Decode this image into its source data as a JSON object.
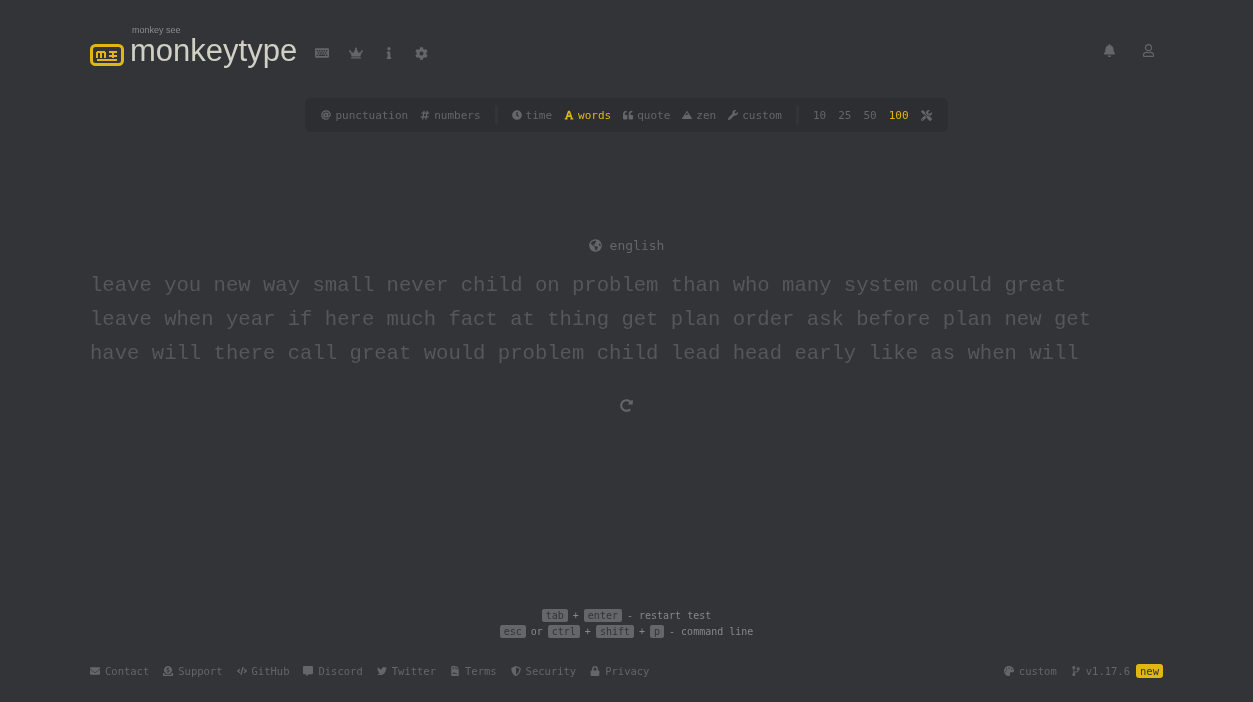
{
  "logo": {
    "tagline": "monkey see",
    "name": "monkeytype"
  },
  "config": {
    "toggles": [
      {
        "kind": "at",
        "label": "punctuation",
        "selected": false
      },
      {
        "kind": "hash",
        "label": "numbers",
        "selected": false
      }
    ],
    "modes": [
      {
        "kind": "clock",
        "label": "time",
        "selected": false
      },
      {
        "kind": "letter",
        "label": "words",
        "selected": true
      },
      {
        "kind": "quote",
        "label": "quote",
        "selected": false
      },
      {
        "kind": "mountain",
        "label": "zen",
        "selected": false
      },
      {
        "kind": "wrench",
        "label": "custom",
        "selected": false
      }
    ],
    "lengths": [
      {
        "label": "10",
        "selected": false
      },
      {
        "label": "25",
        "selected": false
      },
      {
        "label": "50",
        "selected": false
      },
      {
        "label": "100",
        "selected": true
      }
    ]
  },
  "language": "english",
  "words": [
    "leave you new way small never child on problem than who many system could great",
    "leave when year if here much fact at thing get plan order ask before plan new get",
    "have will there call great would problem child lead head early like as when will"
  ],
  "hints": [
    [
      {
        "kind": "key",
        "text": "tab"
      },
      {
        "kind": "text",
        "text": "+"
      },
      {
        "kind": "key",
        "text": "enter"
      },
      {
        "kind": "text",
        "text": "- restart test"
      }
    ],
    [
      {
        "kind": "key",
        "text": "esc"
      },
      {
        "kind": "text",
        "text": "or"
      },
      {
        "kind": "key",
        "text": "ctrl"
      },
      {
        "kind": "text",
        "text": "+"
      },
      {
        "kind": "key",
        "text": "shift"
      },
      {
        "kind": "text",
        "text": "+"
      },
      {
        "kind": "key",
        "text": "p"
      },
      {
        "kind": "text",
        "text": "- command line"
      }
    ]
  ],
  "footer": {
    "links": [
      {
        "kind": "mail",
        "label": "Contact"
      },
      {
        "kind": "donate",
        "label": "Support"
      },
      {
        "kind": "code",
        "label": "GitHub"
      },
      {
        "kind": "chat",
        "label": "Discord"
      },
      {
        "kind": "bird",
        "label": "Twitter"
      },
      {
        "kind": "file",
        "label": "Terms"
      },
      {
        "kind": "shield",
        "label": "Security"
      },
      {
        "kind": "lock",
        "label": "Privacy"
      }
    ],
    "theme": "custom",
    "version": "v1.17.6",
    "badge": "new"
  }
}
